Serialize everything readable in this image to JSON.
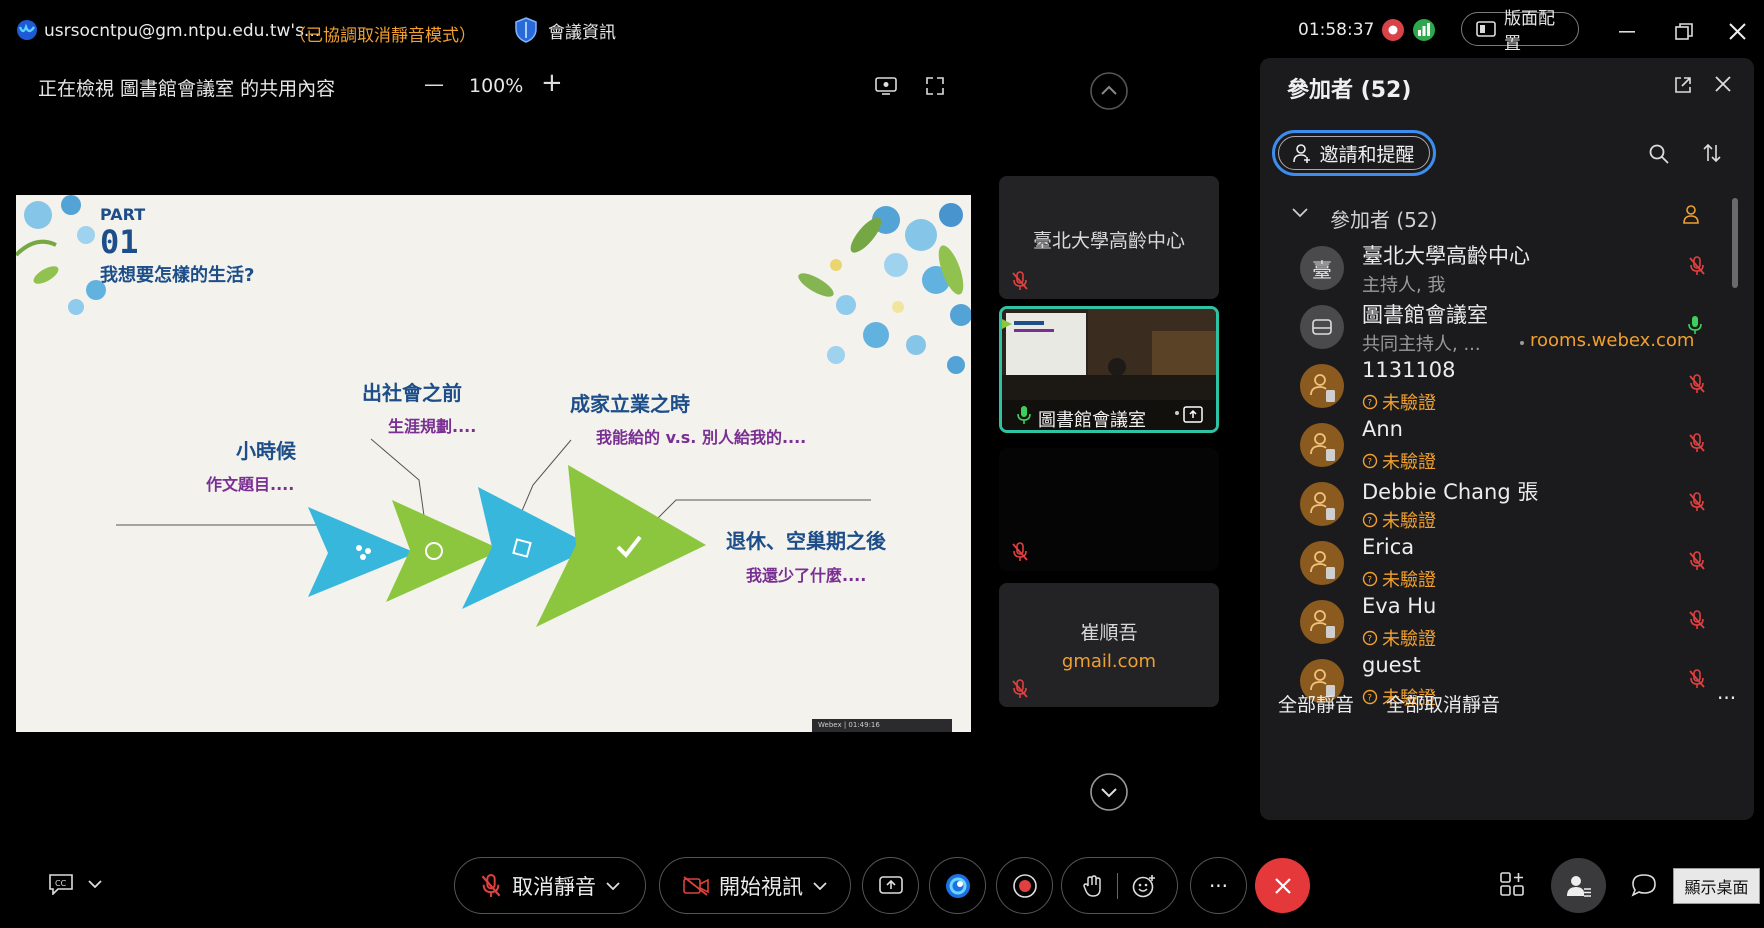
{
  "titlebar": {
    "account": "usrsocntpu@gm.ntpu.edu.tw's...",
    "mode_notice": "（已協調取消靜音模式）",
    "meeting_info": "會議資訊",
    "time": "01:58:37",
    "layout_button": "版面配置"
  },
  "share_bar": {
    "viewing": "正在檢視 圖書館會議室 的共用內容",
    "zoom": "100%",
    "zoom_out": "—",
    "zoom_in": "+"
  },
  "slide": {
    "part_label": "PART",
    "part_number": "01",
    "heading": "我想要怎樣的生活?",
    "stages": [
      {
        "title": "小時候",
        "sub": "作文題目...."
      },
      {
        "title": "出社會之前",
        "sub": "生涯規劃...."
      },
      {
        "title": "成家立業之時",
        "sub": "我能給的 v.s. 別人給我的...."
      },
      {
        "title": "退休、空巢期之後",
        "sub": "我還少了什麼...."
      }
    ],
    "mini_bar": "Webex | 01:49:16"
  },
  "video_tiles": [
    {
      "name": "臺北大學高齡中心"
    },
    {
      "name": "圖書館會議室"
    },
    {
      "name": ""
    },
    {
      "name": "崔順吾",
      "email": "gmail.com"
    }
  ],
  "panel": {
    "title": "參加者 (52)",
    "invite_button": "邀請和提醒",
    "section_label": "參加者 (52)",
    "participants": [
      {
        "name": "臺北大學高齡中心",
        "role": "主持人, 我",
        "avatar": "臺",
        "muted": true
      },
      {
        "name": "圖書館會議室",
        "role": "共同主持人, ...",
        "role_extra": "rooms.webex.com",
        "muted": false
      },
      {
        "name": "1131108",
        "role": "未驗證",
        "muted": true
      },
      {
        "name": "Ann",
        "role": "未驗證",
        "muted": true
      },
      {
        "name": "Debbie Chang 張",
        "role": "未驗證",
        "muted": true
      },
      {
        "name": "Erica",
        "role": "未驗證",
        "muted": true
      },
      {
        "name": "Eva Hu",
        "role": "未驗證",
        "muted": true
      },
      {
        "name": "guest",
        "role": "未驗證",
        "muted": true
      }
    ],
    "mute_all": "全部靜音",
    "unmute_all": "全部取消靜音",
    "more": "···"
  },
  "controls": {
    "unmute": "取消靜音",
    "start_video": "開始視訊",
    "more": "···",
    "show_desktop": "顯示桌面"
  },
  "colors": {
    "accent_orange": "#f0a030",
    "mute_red": "#e0403f",
    "end_red": "#e5383b",
    "green": "#3ecf5a",
    "teal_border": "#2fc3a6",
    "slide_blue": "#38b7dc",
    "slide_green": "#8cc63f",
    "slide_navy": "#1d4e89",
    "slide_purple": "#7a2f93"
  },
  "icons": [
    "webex-logo-icon",
    "shield-icon",
    "record-indicator-icon",
    "audio-level-icon",
    "layout-icon",
    "minimize-icon",
    "restore-icon",
    "close-icon",
    "zoom-out-icon",
    "zoom-in-icon",
    "share-screen-icon",
    "fullscreen-icon",
    "scroll-up-icon",
    "scroll-down-icon",
    "popout-icon",
    "add-person-icon",
    "search-icon",
    "sort-icon",
    "chevron-down-icon",
    "host-icon",
    "muted-mic-icon",
    "mic-icon",
    "closed-captions-icon",
    "video-off-icon",
    "share-icon",
    "ai-assistant-icon",
    "record-icon",
    "raise-hand-icon",
    "reaction-icon",
    "more-icon",
    "end-call-icon",
    "apps-icon",
    "participants-icon",
    "chat-icon"
  ]
}
